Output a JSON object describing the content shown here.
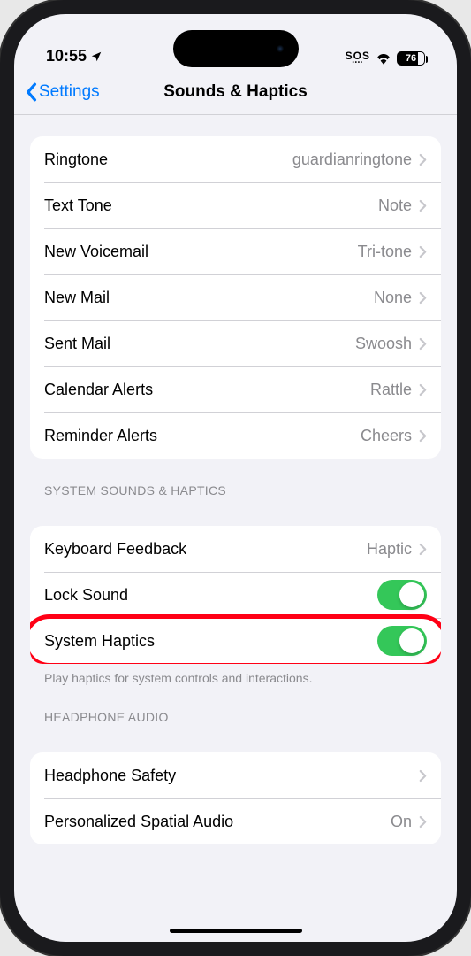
{
  "status": {
    "time": "10:55",
    "sos": "SOS",
    "battery": "76"
  },
  "nav": {
    "back": "Settings",
    "title": "Sounds & Haptics"
  },
  "sounds": [
    {
      "label": "Ringtone",
      "value": "guardianringtone"
    },
    {
      "label": "Text Tone",
      "value": "Note"
    },
    {
      "label": "New Voicemail",
      "value": "Tri-tone"
    },
    {
      "label": "New Mail",
      "value": "None"
    },
    {
      "label": "Sent Mail",
      "value": "Swoosh"
    },
    {
      "label": "Calendar Alerts",
      "value": "Rattle"
    },
    {
      "label": "Reminder Alerts",
      "value": "Cheers"
    }
  ],
  "systemHeader": "System Sounds & Haptics",
  "system": {
    "keyboard": {
      "label": "Keyboard Feedback",
      "value": "Haptic"
    },
    "lock": {
      "label": "Lock Sound"
    },
    "haptics": {
      "label": "System Haptics"
    }
  },
  "footer": "Play haptics for system controls and interactions.",
  "headphoneHeader": "Headphone Audio",
  "headphone": {
    "safety": {
      "label": "Headphone Safety",
      "value": ""
    },
    "spatial": {
      "label": "Personalized Spatial Audio",
      "value": "On"
    }
  }
}
